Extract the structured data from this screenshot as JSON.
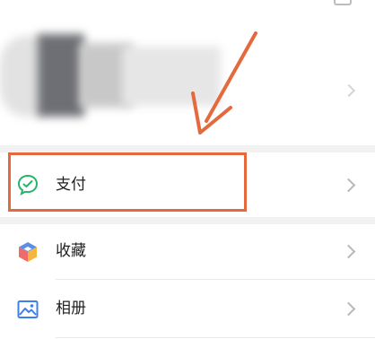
{
  "menu": {
    "items": [
      {
        "label": "支付",
        "icon": "wechat-pay-icon"
      },
      {
        "label": "收藏",
        "icon": "favorites-cube-icon"
      },
      {
        "label": "相册",
        "icon": "album-picture-icon"
      }
    ]
  },
  "colors": {
    "annotation": "#e46a3e",
    "pay_icon": "#27b36b",
    "chevron": "#b8b8b8"
  }
}
